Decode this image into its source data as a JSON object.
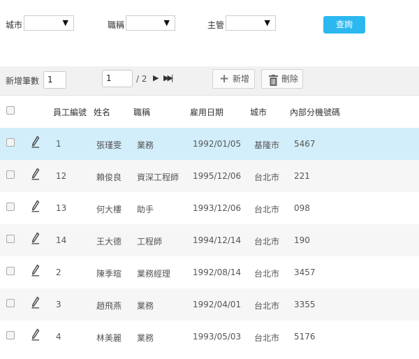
{
  "filters": {
    "city_label": "城市",
    "title_label": "職稱",
    "manager_label": "主管",
    "query_button": "查詢"
  },
  "toolbar": {
    "add_count_label": "新增筆數",
    "add_count_value": "1",
    "page_value": "1",
    "page_total": "/ 2",
    "add_button": "新增",
    "delete_button": "刪除"
  },
  "table": {
    "columns": [
      "員工編號",
      "姓名",
      "職稱",
      "雇用日期",
      "城市",
      "內部分機號碼"
    ],
    "rows": [
      {
        "id": "1",
        "name": "張瑾雯",
        "title": "業務",
        "hire_date": "1992/01/05",
        "city": "基隆市",
        "ext": "5467",
        "selected": true
      },
      {
        "id": "12",
        "name": "賴俊良",
        "title": "資深工程師",
        "hire_date": "1995/12/06",
        "city": "台北市",
        "ext": "221",
        "selected": false
      },
      {
        "id": "13",
        "name": "何大樓",
        "title": "助手",
        "hire_date": "1993/12/06",
        "city": "台北市",
        "ext": "098",
        "selected": false
      },
      {
        "id": "14",
        "name": "王大德",
        "title": "工程師",
        "hire_date": "1994/12/14",
        "city": "台北市",
        "ext": "190",
        "selected": false
      },
      {
        "id": "2",
        "name": "陳季暄",
        "title": "業務經理",
        "hire_date": "1992/08/14",
        "city": "台北市",
        "ext": "3457",
        "selected": false
      },
      {
        "id": "3",
        "name": "趙飛燕",
        "title": "業務",
        "hire_date": "1992/04/01",
        "city": "台北市",
        "ext": "3355",
        "selected": false
      },
      {
        "id": "4",
        "name": "林美麗",
        "title": "業務",
        "hire_date": "1993/05/03",
        "city": "台北市",
        "ext": "5176",
        "selected": false
      }
    ]
  },
  "colors": {
    "accent": "#2bb8f0",
    "selected_row": "#d2eefb",
    "alt_row": "#f6f6f6",
    "toolbar_bg": "#f1f1f1"
  },
  "icons": {
    "dropdown": "caret-down-icon",
    "next_page": "play-icon",
    "last_page": "fast-forward-icon",
    "add": "plus-icon",
    "delete": "trash-icon",
    "edit": "pencil-icon"
  }
}
